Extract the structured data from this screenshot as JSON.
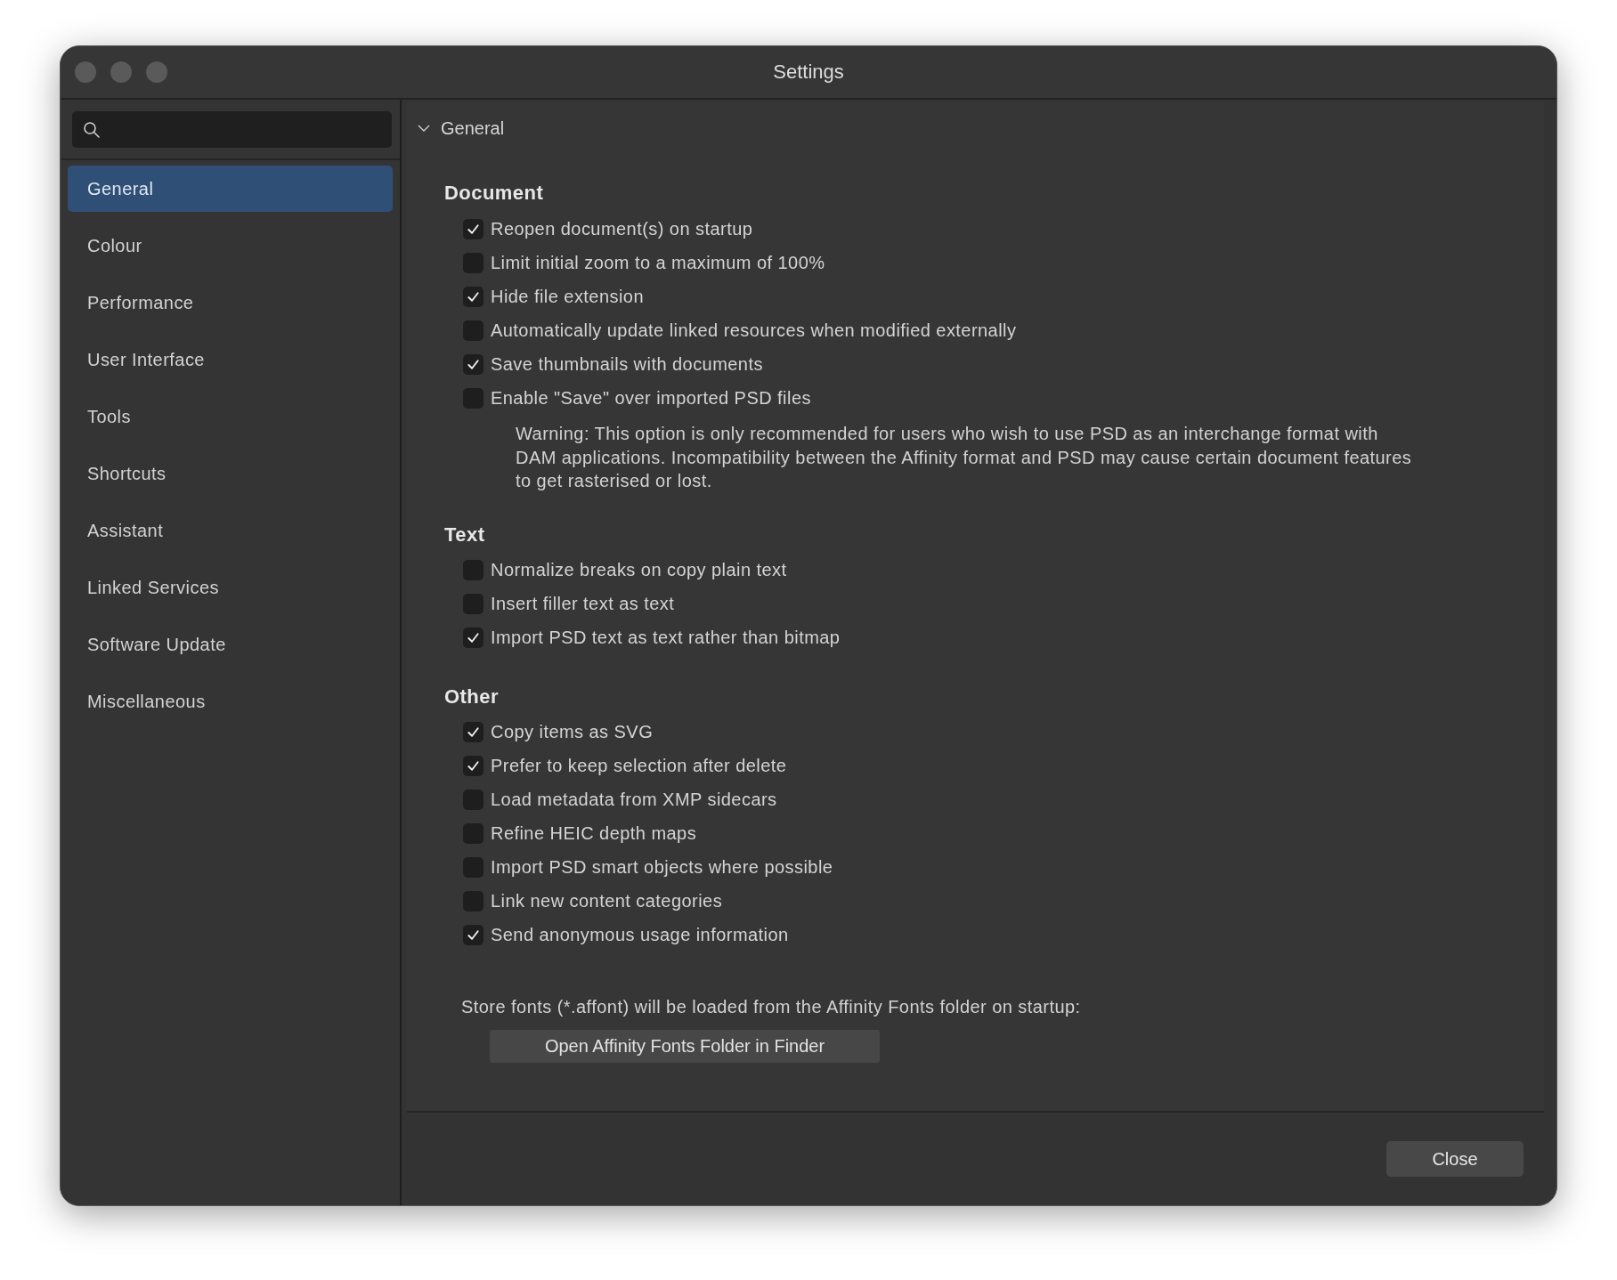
{
  "window": {
    "title": "Settings"
  },
  "sidebar": {
    "items": [
      {
        "label": "General",
        "selected": true
      },
      {
        "label": "Colour",
        "selected": false
      },
      {
        "label": "Performance",
        "selected": false
      },
      {
        "label": "User Interface",
        "selected": false
      },
      {
        "label": "Tools",
        "selected": false
      },
      {
        "label": "Shortcuts",
        "selected": false
      },
      {
        "label": "Assistant",
        "selected": false
      },
      {
        "label": "Linked Services",
        "selected": false
      },
      {
        "label": "Software Update",
        "selected": false
      },
      {
        "label": "Miscellaneous",
        "selected": false
      }
    ]
  },
  "section": {
    "title": "General",
    "expanded": true,
    "groups": [
      {
        "title": "Document",
        "options": [
          {
            "label": "Reopen document(s) on startup",
            "checked": true
          },
          {
            "label": "Limit initial zoom to a maximum of 100%",
            "checked": false
          },
          {
            "label": "Hide file extension",
            "checked": true
          },
          {
            "label": "Automatically update linked resources when modified externally",
            "checked": false
          },
          {
            "label": "Save thumbnails with documents",
            "checked": true
          },
          {
            "label": "Enable \"Save\" over imported PSD files",
            "checked": false
          }
        ],
        "note": "Warning: This option is only recommended for users who wish to use PSD as an interchange format with DAM applications. Incompatibility between the Affinity format and PSD may cause certain document features to get rasterised or lost."
      },
      {
        "title": "Text",
        "options": [
          {
            "label": "Normalize breaks on copy plain text",
            "checked": false
          },
          {
            "label": "Insert filler text as text",
            "checked": false
          },
          {
            "label": "Import PSD text as text rather than bitmap",
            "checked": true
          }
        ]
      },
      {
        "title": "Other",
        "options": [
          {
            "label": "Copy items as SVG",
            "checked": true
          },
          {
            "label": "Prefer to keep selection after delete",
            "checked": true
          },
          {
            "label": "Load metadata from XMP sidecars",
            "checked": false
          },
          {
            "label": "Refine HEIC depth maps",
            "checked": false
          },
          {
            "label": "Import PSD smart objects where possible",
            "checked": false
          },
          {
            "label": "Link new content categories",
            "checked": false
          },
          {
            "label": "Send anonymous usage information",
            "checked": true
          }
        ]
      }
    ],
    "fonts_note": "Store fonts (*.affont) will be loaded from the Affinity Fonts folder on startup:",
    "fonts_button": "Open Affinity Fonts Folder in Finder"
  },
  "close_button": "Close"
}
